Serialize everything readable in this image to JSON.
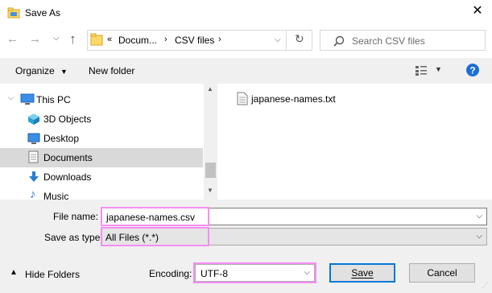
{
  "window": {
    "title": "Save As"
  },
  "nav": {
    "breadcrumb_prefix": "«",
    "breadcrumb_documents": "Docum...",
    "breadcrumb_folder": "CSV files",
    "search_placeholder": "Search CSV files"
  },
  "commandbar": {
    "organize": "Organize",
    "new_folder": "New folder"
  },
  "tree": {
    "items": [
      {
        "label": "This PC",
        "icon": "pc-icon"
      },
      {
        "label": "3D Objects",
        "icon": "cube-icon"
      },
      {
        "label": "Desktop",
        "icon": "desktop-icon"
      },
      {
        "label": "Documents",
        "icon": "documents-icon",
        "selected": true
      },
      {
        "label": "Downloads",
        "icon": "download-icon"
      },
      {
        "label": "Music",
        "icon": "music-icon"
      }
    ]
  },
  "files": [
    {
      "name": "japanese-names.txt",
      "icon": "text-file-icon"
    }
  ],
  "form": {
    "filename_label": "File name:",
    "filename_value": "japanese-names.csv",
    "savetype_label": "Save as type:",
    "savetype_value": "All Files  (*.*)",
    "encoding_label": "Encoding:",
    "encoding_value": "UTF-8",
    "hide_folders": "Hide Folders",
    "save": "Save",
    "cancel": "Cancel"
  },
  "colors": {
    "selection": "#cce8ff",
    "highlight": "#f58ef5",
    "help": "#1a6ed8",
    "folder": "#ffd968"
  }
}
